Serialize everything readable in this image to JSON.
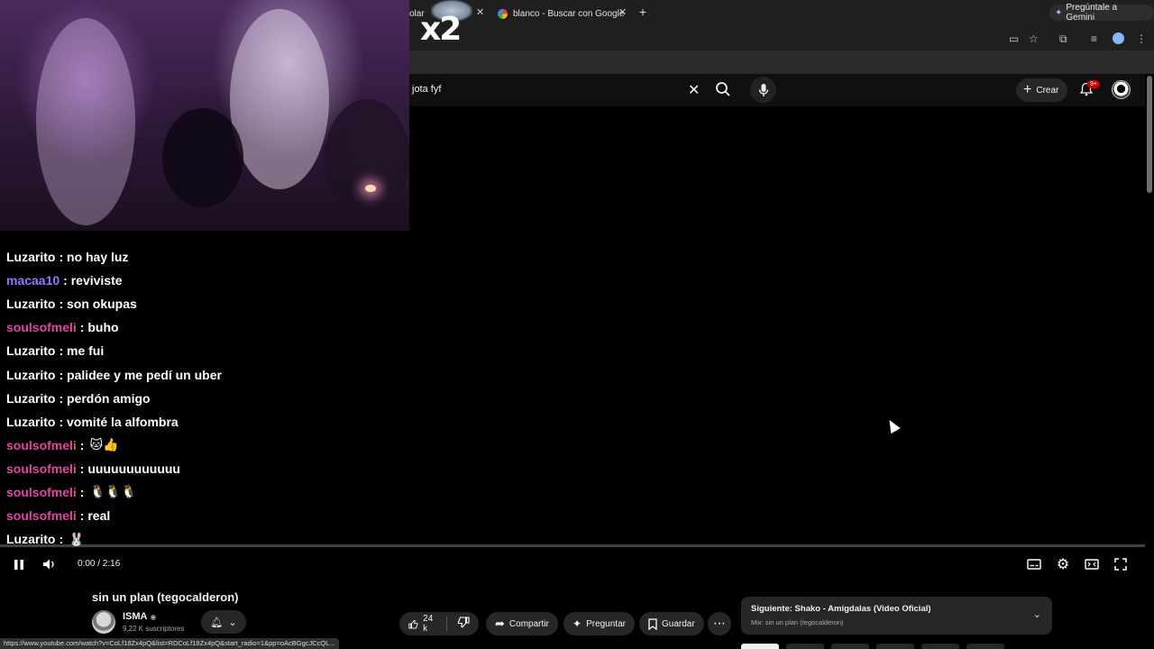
{
  "browser": {
    "tabs": [
      {
        "label": "olar",
        "active": false
      },
      {
        "label": "blanco - Buscar con Google",
        "active": false
      }
    ],
    "new_tab_label": "+",
    "gemini_label": "Pregúntale a Gemini",
    "overlay_badge": "x2"
  },
  "youtube": {
    "search": {
      "query": "jota fyf"
    },
    "create_label": "Crear",
    "notification_count": "9+"
  },
  "chat": [
    {
      "user": "Luzarito",
      "user_color": "#ffffff",
      "message": "no hay luz",
      "emote": ""
    },
    {
      "user": "macaa10",
      "user_color": "#8b7bff",
      "message": "reviviste",
      "emote": ""
    },
    {
      "user": "Luzarito",
      "user_color": "#ffffff",
      "message": "son okupas",
      "emote": ""
    },
    {
      "user": "soulsofmeli",
      "user_color": "#e0479e",
      "message": "buho",
      "emote": ""
    },
    {
      "user": "Luzarito",
      "user_color": "#ffffff",
      "message": "me fui",
      "emote": ""
    },
    {
      "user": "Luzarito",
      "user_color": "#ffffff",
      "message": "palidee y me pedí un uber",
      "emote": ""
    },
    {
      "user": "Luzarito",
      "user_color": "#ffffff",
      "message": "perdón amigo",
      "emote": ""
    },
    {
      "user": "Luzarito",
      "user_color": "#ffffff",
      "message": "vomité la alfombra",
      "emote": ""
    },
    {
      "user": "soulsofmeli",
      "user_color": "#e0479e",
      "message": "",
      "emote": "🐱👍"
    },
    {
      "user": "soulsofmeli",
      "user_color": "#e0479e",
      "message": "uuuuuuuuuuuu",
      "emote": ""
    },
    {
      "user": "soulsofmeli",
      "user_color": "#e0479e",
      "message": "",
      "emote": "🐧🐧🐧"
    },
    {
      "user": "soulsofmeli",
      "user_color": "#e0479e",
      "message": "real",
      "emote": ""
    },
    {
      "user": "Luzarito",
      "user_color": "#ffffff",
      "message": "",
      "emote": "🐰"
    }
  ],
  "player": {
    "time_display": "0:00 / 2:16",
    "progress": 0.0
  },
  "video": {
    "title": "sin un plan (tegocalderon)",
    "channel": "ISMA",
    "subscribers": "9,22 K suscriptores",
    "likes": "24 k",
    "share_label": "Compartir",
    "ask_label": "Preguntar",
    "save_label": "Guardar"
  },
  "up_next": {
    "title": "Siguiente: Shako - Amígdalas (Video Oficial)",
    "subtitle": "Mix: sin un plan (tegocalderon)"
  },
  "status_url": "https://www.youtube.com/watch?v=CoLf18Zx4pQ&list=RDCoLf18Zx4pQ&start_radio=1&pp=oAcBGgcJCcQL...",
  "colors": {
    "accent": "#ff0033",
    "background": "#000000",
    "surface": "#272727"
  }
}
